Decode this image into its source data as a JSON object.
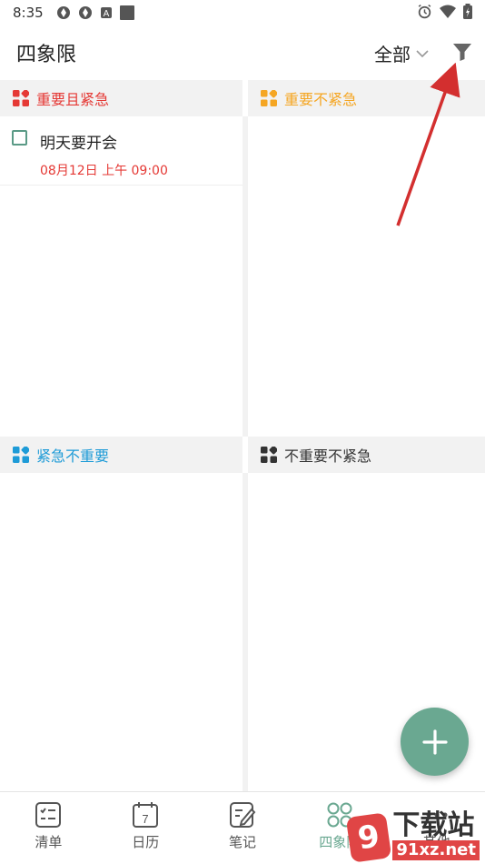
{
  "status_bar": {
    "time": "8:35",
    "left_icons": [
      "app-notification-icon",
      "app-notification-icon",
      "a-box-icon",
      "square-icon"
    ],
    "right_icons": [
      "alarm-icon",
      "wifi-icon",
      "battery-charging-icon"
    ]
  },
  "app_bar": {
    "title": "四象限",
    "filter_label": "全部",
    "filter_icon": "funnel-icon"
  },
  "quadrants": [
    {
      "label": "重要且紧急",
      "color": "#e53935",
      "tasks": [
        {
          "title": "明天要开会",
          "due": "08月12日 上午 09:00"
        }
      ]
    },
    {
      "label": "重要不紧急",
      "color": "#f5a623",
      "tasks": []
    },
    {
      "label": "紧急不重要",
      "color": "#1e9bd7",
      "tasks": []
    },
    {
      "label": "不重要不紧急",
      "color": "#333333",
      "tasks": []
    }
  ],
  "fab": {
    "icon": "plus-icon",
    "color": "#6aa891"
  },
  "bottom_nav": [
    {
      "label": "清单",
      "icon": "checklist-icon"
    },
    {
      "label": "日历",
      "icon": "calendar-icon",
      "badge": "7"
    },
    {
      "label": "笔记",
      "icon": "note-edit-icon"
    },
    {
      "label": "四象限",
      "icon": "quadrant-icon",
      "active": true
    },
    {
      "label": "其他",
      "icon": "more-icon"
    }
  ],
  "watermark": {
    "title": "下载站",
    "domain": "91xz.net"
  }
}
